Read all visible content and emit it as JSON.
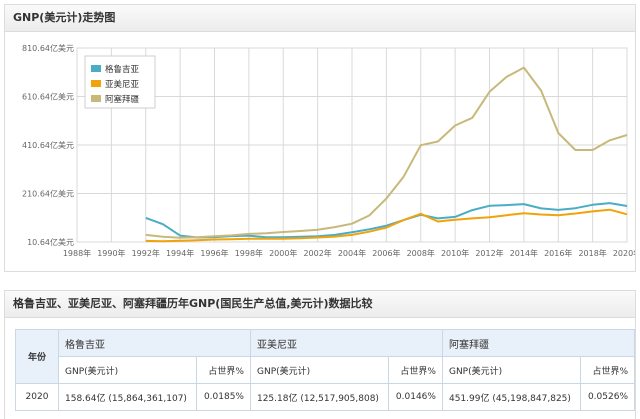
{
  "chart_panel": {
    "title": "GNP(美元计)走势图"
  },
  "chart_data": {
    "type": "line",
    "title": "GNP(美元计)走势图",
    "y_ticks": [
      "10.64亿美元",
      "210.64亿美元",
      "410.64亿美元",
      "610.64亿美元",
      "810.64亿美元"
    ],
    "y_tick_values": [
      10.64,
      210.64,
      410.64,
      610.64,
      810.64
    ],
    "ylim": [
      10.64,
      810.64
    ],
    "x_ticks": [
      "1988年",
      "1990年",
      "1992年",
      "1994年",
      "1996年",
      "1998年",
      "2000年",
      "2002年",
      "2004年",
      "2006年",
      "2008年",
      "2010年",
      "2012年",
      "2014年",
      "2016年",
      "2018年",
      "2020年"
    ],
    "x_tick_values": [
      1988,
      1990,
      1992,
      1994,
      1996,
      1998,
      2000,
      2002,
      2004,
      2006,
      2008,
      2010,
      2012,
      2014,
      2016,
      2018,
      2020
    ],
    "xlim": [
      1988,
      2020
    ],
    "grid": true,
    "legend": "top-left",
    "series": [
      {
        "name": "格鲁吉亚",
        "color": "#4bacc6",
        "x": [
          1992,
          1993,
          1994,
          1995,
          1996,
          1997,
          1998,
          1999,
          2000,
          2001,
          2002,
          2003,
          2004,
          2005,
          2006,
          2007,
          2008,
          2009,
          2010,
          2011,
          2012,
          2013,
          2014,
          2015,
          2016,
          2017,
          2018,
          2019,
          2020
        ],
        "y": [
          110,
          84,
          37,
          29,
          31,
          35,
          37,
          30,
          30,
          32,
          34,
          40,
          51,
          63,
          78,
          101,
          123,
          108,
          114,
          142,
          160,
          163,
          167,
          149,
          143,
          150,
          164,
          171,
          159
        ]
      },
      {
        "name": "亚美尼亚",
        "color": "#f0a30a",
        "x": [
          1992,
          1993,
          1994,
          1995,
          1996,
          1997,
          1998,
          1999,
          2000,
          2001,
          2002,
          2003,
          2004,
          2005,
          2006,
          2007,
          2008,
          2009,
          2010,
          2011,
          2012,
          2013,
          2014,
          2015,
          2016,
          2017,
          2018,
          2019,
          2020
        ],
        "y": [
          15,
          14,
          16,
          18,
          21,
          22,
          24,
          24,
          24,
          26,
          29,
          33,
          40,
          53,
          70,
          101,
          127,
          95,
          102,
          108,
          113,
          121,
          129,
          124,
          121,
          128,
          137,
          144,
          125
        ]
      },
      {
        "name": "阿塞拜疆",
        "color": "#c8b87a",
        "x": [
          1992,
          1993,
          1994,
          1995,
          1996,
          1997,
          1998,
          1999,
          2000,
          2001,
          2002,
          2003,
          2004,
          2005,
          2006,
          2007,
          2008,
          2009,
          2010,
          2011,
          2012,
          2013,
          2014,
          2015,
          2016,
          2017,
          2018,
          2019,
          2020
        ],
        "y": [
          40,
          32,
          28,
          30,
          34,
          38,
          44,
          47,
          52,
          56,
          61,
          72,
          86,
          120,
          190,
          280,
          410,
          425,
          491,
          523,
          630,
          692,
          730,
          635,
          460,
          390,
          390,
          430,
          452
        ]
      }
    ]
  },
  "table_panel": {
    "title": "格鲁吉亚、亚美尼亚、阿塞拜疆历年GNP(国民生产总值,美元计)数据比较"
  },
  "table": {
    "year_header": "年份",
    "countries": [
      "格鲁吉亚",
      "亚美尼亚",
      "阿塞拜疆"
    ],
    "gnp_header": "GNP(美元计)",
    "share_header": "占世界%",
    "rows": [
      {
        "year": "2020",
        "cells": [
          {
            "gnp": "158.64亿 (15,864,361,107)",
            "share": "0.0185%"
          },
          {
            "gnp": "125.18亿 (12,517,905,808)",
            "share": "0.0146%"
          },
          {
            "gnp": "451.99亿 (45,198,847,825)",
            "share": "0.0526%"
          }
        ]
      }
    ]
  }
}
